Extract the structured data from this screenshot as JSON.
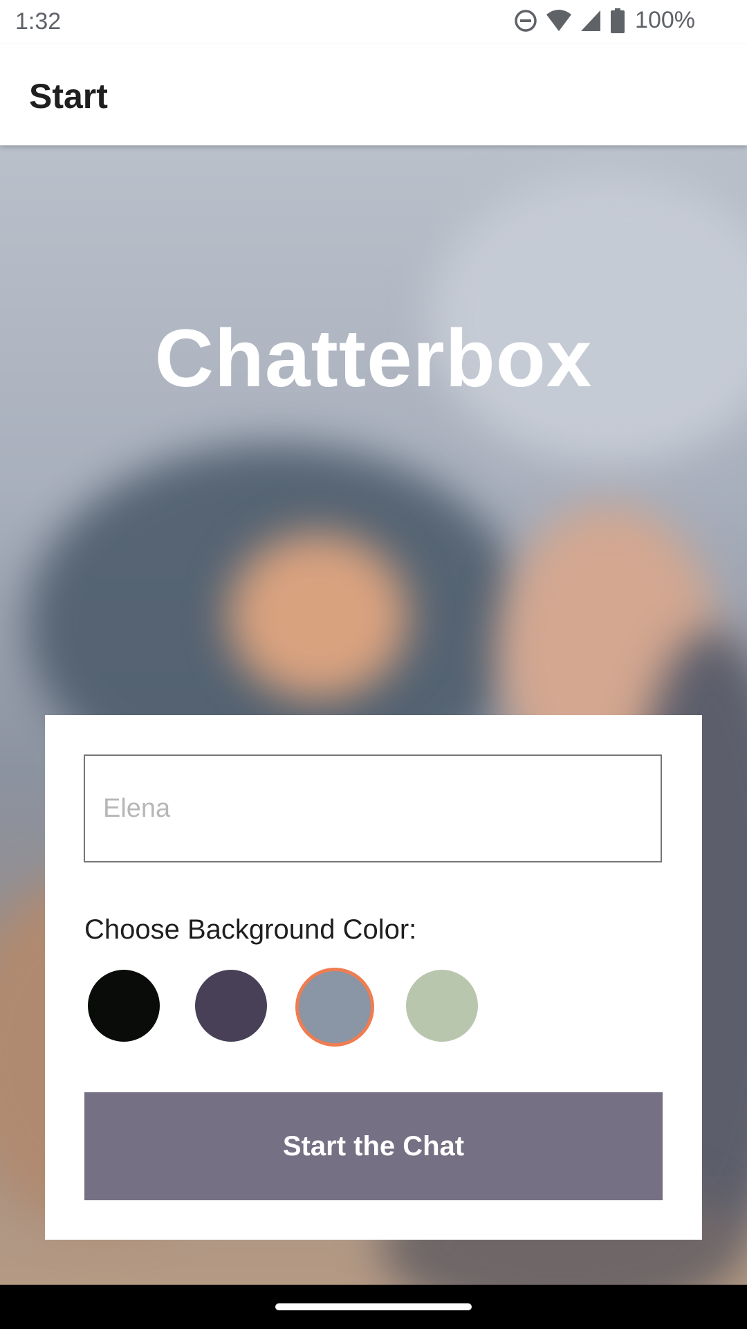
{
  "status_bar": {
    "time": "1:32",
    "battery": "100%",
    "icons": [
      "do-not-disturb-icon",
      "wifi-icon",
      "signal-icon",
      "battery-icon"
    ]
  },
  "app_bar": {
    "title": "Start"
  },
  "hero": {
    "title": "Chatterbox"
  },
  "form": {
    "name_value": "",
    "name_placeholder": "Elena",
    "color_label": "Choose Background Color:",
    "colors": [
      {
        "name": "black",
        "hex": "#090C08",
        "selected": false
      },
      {
        "name": "dark-purple",
        "hex": "#474056",
        "selected": false
      },
      {
        "name": "slate-blue-gray",
        "hex": "#8A95A5",
        "selected": true
      },
      {
        "name": "sage-green",
        "hex": "#B9C6AE",
        "selected": false
      }
    ],
    "selected_border_color": "#EE7D52",
    "start_button_label": "Start the Chat",
    "start_button_color": "#757083"
  }
}
